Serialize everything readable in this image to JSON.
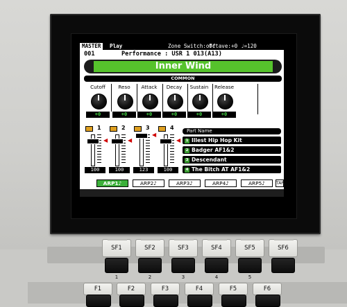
{
  "header": {
    "master": "MASTER",
    "play": "Play",
    "zone_switch": "Zone Switch:off",
    "octave": "Octave:+0",
    "tempo": "♩=120"
  },
  "performance": {
    "number": "001",
    "label": "Performance : USR 1 013(A13)",
    "name": "Inner Wind"
  },
  "common_label": "COMMON",
  "knobs": [
    {
      "label": "Cutoff",
      "value": "+0"
    },
    {
      "label": "Reso",
      "value": "+0"
    },
    {
      "label": "Attack",
      "value": "+0"
    },
    {
      "label": "Decay",
      "value": "+0"
    },
    {
      "label": "Sustain",
      "value": "+0"
    },
    {
      "label": "Release",
      "value": "+0"
    }
  ],
  "parts": [
    {
      "number": "1",
      "value": "100",
      "level": 0.79
    },
    {
      "number": "2",
      "value": "100",
      "level": 0.79
    },
    {
      "number": "3",
      "value": "123",
      "level": 0.97
    },
    {
      "number": "4",
      "value": "100",
      "level": 0.79
    }
  ],
  "part_list": {
    "header": "Part Name",
    "items": [
      {
        "badge": "1",
        "name": "Illest Hip Hop Kit"
      },
      {
        "badge": "2",
        "name": "Badger AF1&2"
      },
      {
        "badge": "3",
        "name": "Descendant"
      },
      {
        "badge": "4",
        "name": "The Bitch AT AF1&2"
      }
    ]
  },
  "arp_buttons": [
    {
      "label": "ARP1♪",
      "active": true
    },
    {
      "label": "ARP2♪",
      "active": false
    },
    {
      "label": "ARP3♪",
      "active": false
    },
    {
      "label": "ARP4♪",
      "active": false
    },
    {
      "label": "ARP5♪",
      "active": false
    },
    {
      "label": "TAP",
      "active": false
    }
  ],
  "sf_keys": [
    "SF1",
    "SF2",
    "SF3",
    "SF4",
    "SF5",
    "SF6"
  ],
  "sf_numbers": [
    "1",
    "2",
    "3",
    "4",
    "5"
  ],
  "f_keys": [
    "F1",
    "F2",
    "F3",
    "F4",
    "F5",
    "F6"
  ]
}
